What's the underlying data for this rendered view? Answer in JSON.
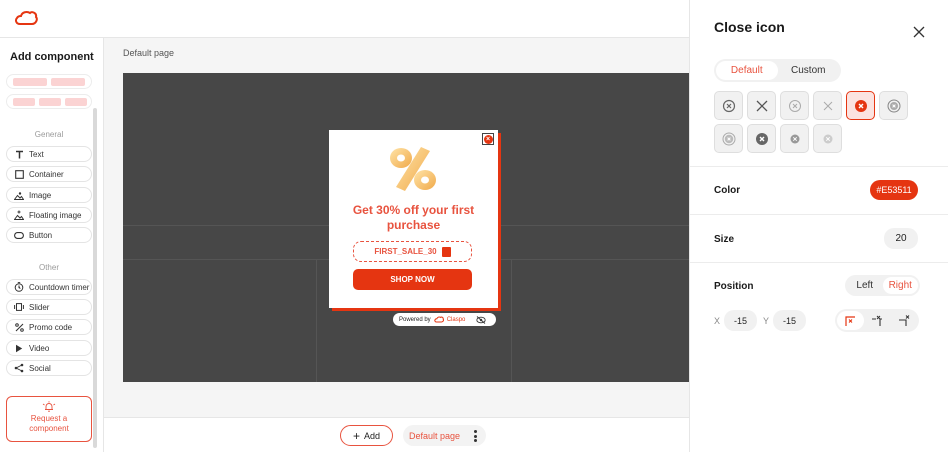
{
  "sidebar": {
    "title": "Add component",
    "general_label": "General",
    "other_label": "Other",
    "general_items": [
      {
        "label": "Text",
        "icon": "text-icon"
      },
      {
        "label": "Container",
        "icon": "square-icon"
      },
      {
        "label": "Image",
        "icon": "image-icon"
      },
      {
        "label": "Floating image",
        "icon": "floating-image-icon"
      },
      {
        "label": "Button",
        "icon": "button-icon"
      }
    ],
    "other_items": [
      {
        "label": "Countdown timer",
        "icon": "timer-icon"
      },
      {
        "label": "Slider",
        "icon": "slider-icon"
      },
      {
        "label": "Promo code",
        "icon": "percent-icon"
      },
      {
        "label": "Video",
        "icon": "play-icon"
      },
      {
        "label": "Social",
        "icon": "share-icon"
      }
    ],
    "request_label": "Request a component"
  },
  "workspace": {
    "page_label": "Default page"
  },
  "popup": {
    "headline": "Get 30% off your first purchase",
    "promo_code": "FIRST_SALE_30",
    "cta": "SHOP NOW",
    "powered_prefix": "Powered by",
    "powered_brand": "Claspo"
  },
  "bottombar": {
    "add_label": "Add",
    "page_name": "Default page"
  },
  "panel": {
    "title": "Close icon",
    "mode_tabs": [
      "Default",
      "Custom"
    ],
    "active_mode": "Default",
    "color_label": "Color",
    "color_value": "#E53511",
    "size_label": "Size",
    "size_value": "20",
    "position_label": "Position",
    "position_options": [
      "Left",
      "Right"
    ],
    "active_position": "Right",
    "x_label": "X",
    "x_value": "-15",
    "y_label": "Y",
    "y_value": "-15"
  },
  "colors": {
    "accent": "#E53511",
    "accent_light": "#E8533F",
    "canvas": "#474747"
  }
}
